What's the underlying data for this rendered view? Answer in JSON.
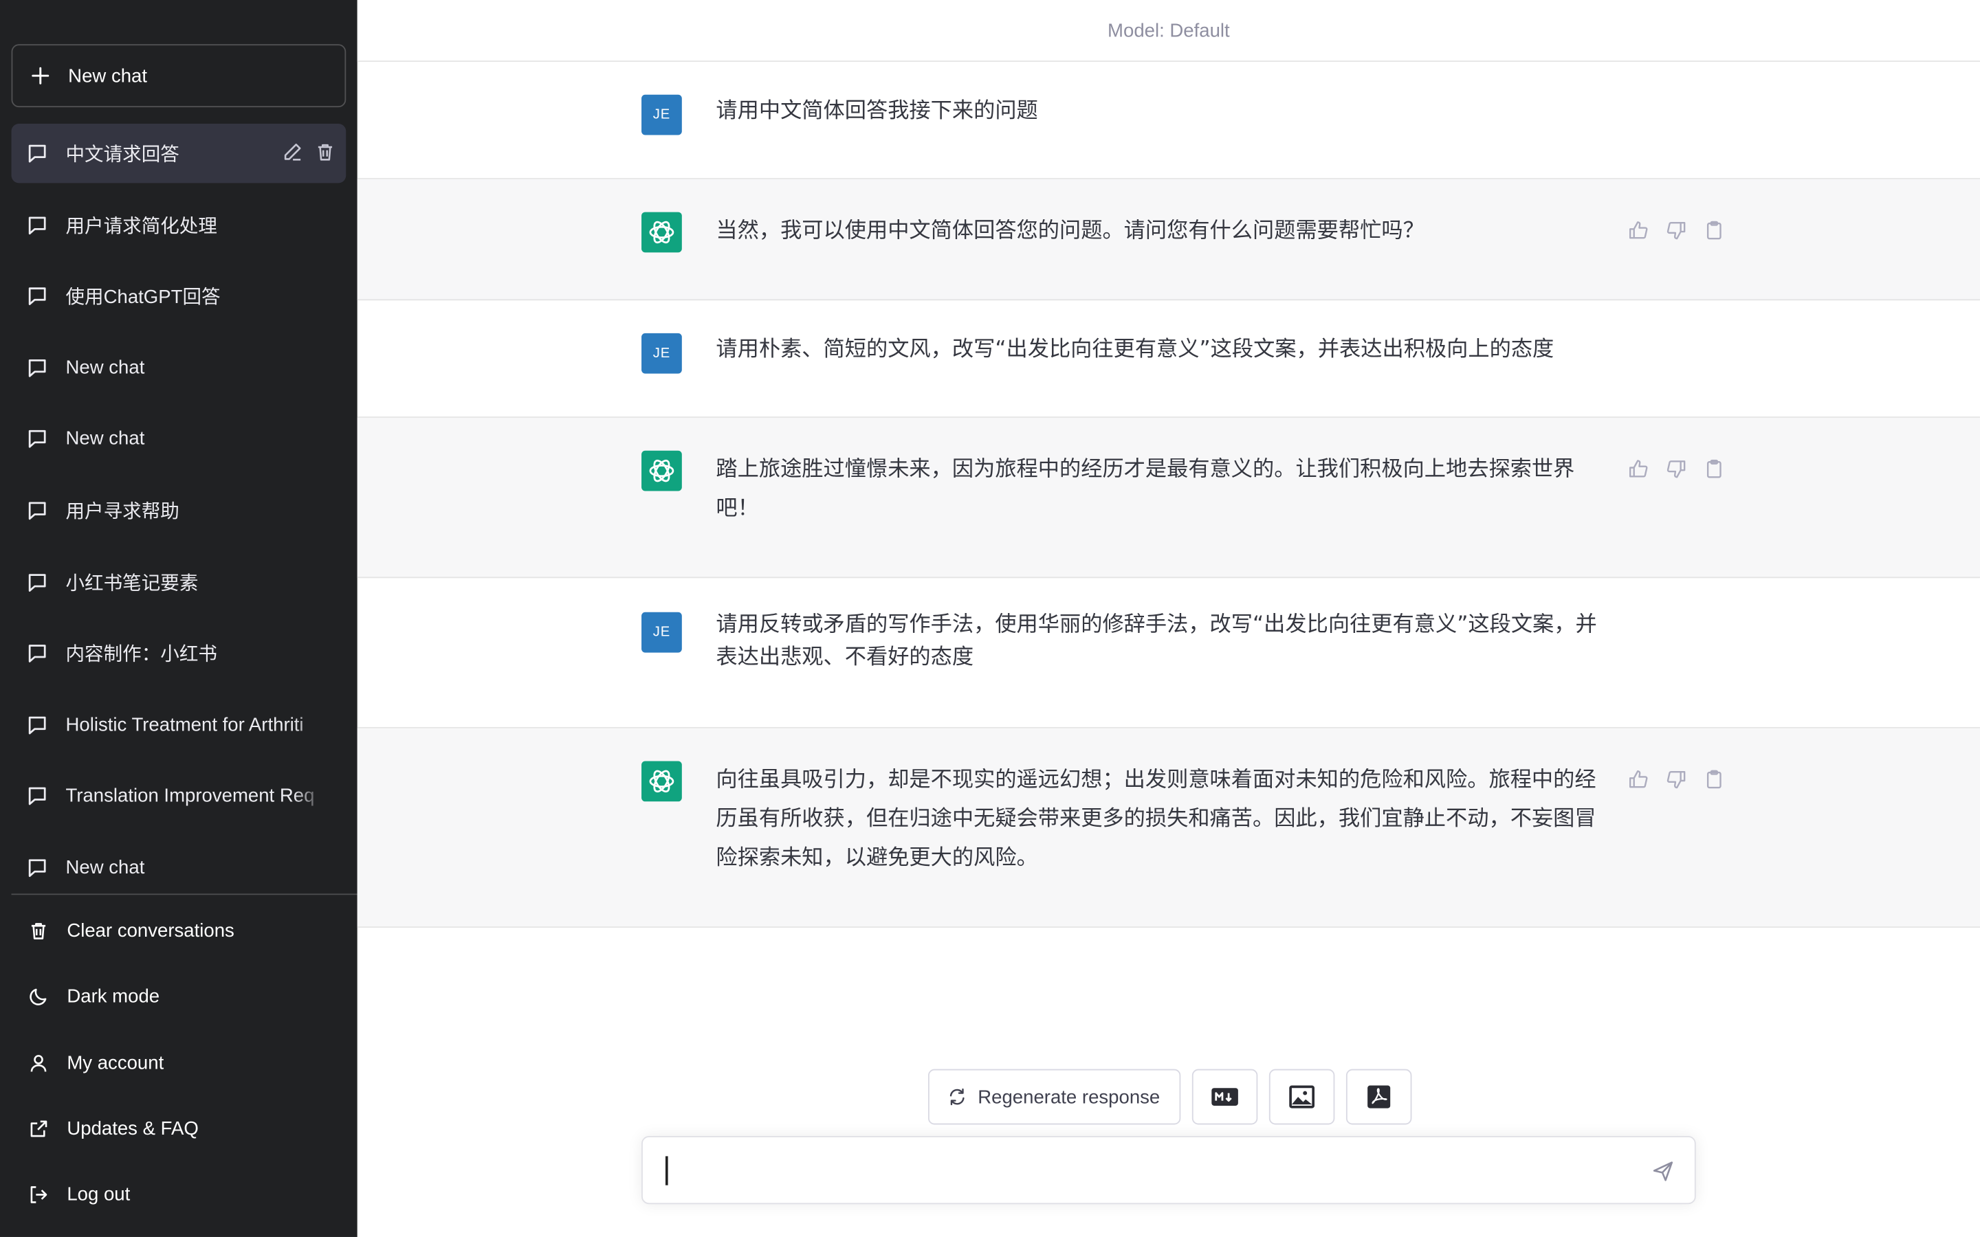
{
  "sidebar": {
    "new_chat_label": "New chat",
    "conversations": [
      {
        "label": "中文请求回答"
      },
      {
        "label": "用户请求简化处理"
      },
      {
        "label": "使用ChatGPT回答"
      },
      {
        "label": "New chat"
      },
      {
        "label": "New chat"
      },
      {
        "label": "用户寻求帮助"
      },
      {
        "label": "小红书笔记要素"
      },
      {
        "label": "内容制作：小红书"
      },
      {
        "label": "Holistic Treatment for Arthriti"
      },
      {
        "label": "Translation Improvement Req"
      },
      {
        "label": "New chat"
      }
    ],
    "menu": [
      {
        "label": "Clear conversations",
        "icon": "trash-icon"
      },
      {
        "label": "Dark mode",
        "icon": "moon-icon"
      },
      {
        "label": "My account",
        "icon": "user-icon"
      },
      {
        "label": "Updates & FAQ",
        "icon": "external-link-icon"
      },
      {
        "label": "Log out",
        "icon": "logout-icon"
      }
    ]
  },
  "header": {
    "model_label": "Model: Default"
  },
  "messages": [
    {
      "role": "user",
      "avatar": "JE",
      "text": "请用中文简体回答我接下来的问题"
    },
    {
      "role": "assistant",
      "text": "当然，我可以使用中文简体回答您的问题。请问您有什么问题需要帮忙吗？"
    },
    {
      "role": "user",
      "avatar": "JE",
      "text": "请用朴素、简短的文风，改写“出发比向往更有意义”这段文案，并表达出积极向上的态度"
    },
    {
      "role": "assistant",
      "text": "踏上旅途胜过憧憬未来，因为旅程中的经历才是最有意义的。让我们积极向上地去探索世界吧！"
    },
    {
      "role": "user",
      "avatar": "JE",
      "text": "请用反转或矛盾的写作手法，使用华丽的修辞手法，改写“出发比向往更有意义”这段文案，并表达出悲观、不看好的态度"
    },
    {
      "role": "assistant",
      "text": "向往虽具吸引力，却是不现实的遥远幻想；出发则意味着面对未知的危险和风险。旅程中的经历虽有所收获，但在归途中无疑会带来更多的损失和痛苦。因此，我们宜静止不动，不妄图冒险探索未知，以避免更大的风险。"
    }
  ],
  "actions": {
    "regenerate_label": "Regenerate response",
    "buttons": [
      "markdown-icon",
      "image-icon",
      "pdf-icon"
    ]
  },
  "input": {
    "value": "",
    "placeholder": ""
  },
  "colors": {
    "sidebar_bg": "#202123",
    "user_avatar": "#2b7bbf",
    "gpt_avatar": "#10a37f",
    "bot_row_bg": "#f7f7f8"
  }
}
